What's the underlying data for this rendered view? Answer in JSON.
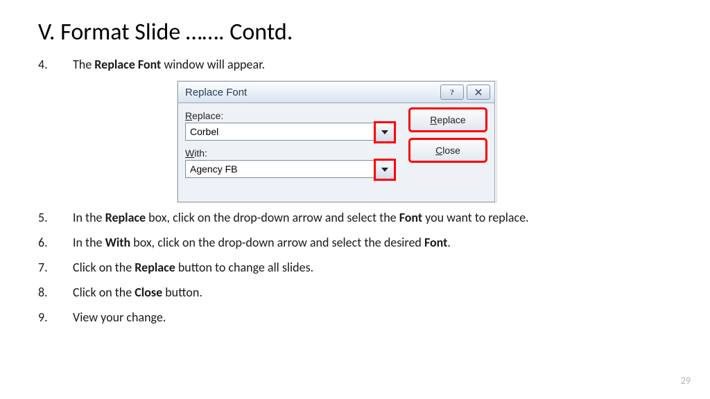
{
  "title": "V. Format Slide  ……. Contd.",
  "page_number": "29",
  "steps": [
    {
      "num": "4.",
      "pre": "The ",
      "bold": "Replace Font",
      "post": " window will appear."
    },
    {
      "num": "5.",
      "pre": "In the ",
      "bold": "Replace",
      "mid": " box, click on the drop-down arrow and select the ",
      "bold2": "Font",
      "post": " you want to replace."
    },
    {
      "num": "6.",
      "pre": "In the ",
      "bold": "With",
      "mid": " box, click on the drop-down arrow and select the desired ",
      "bold2": "Font",
      "post": "."
    },
    {
      "num": "7.",
      "pre": "Click on the ",
      "bold": "Replace",
      "post": " button to change all slides."
    },
    {
      "num": "8.",
      "pre": "Click on the ",
      "bold": "Close",
      "post": " button."
    },
    {
      "num": "9.",
      "pre": "View your change.",
      "bold": "",
      "post": ""
    }
  ],
  "dialog": {
    "title": "Replace Font",
    "help_icon": "?",
    "close_icon": "✕",
    "replace_label": "Replace:",
    "replace_label_ul": "R",
    "replace_value": "Corbel",
    "with_label": "ith:",
    "with_label_ul": "W",
    "with_value": "Agency FB",
    "btn_replace_ul": "R",
    "btn_replace_rest": "eplace",
    "btn_close_ul": "C",
    "btn_close_rest": "lose"
  }
}
